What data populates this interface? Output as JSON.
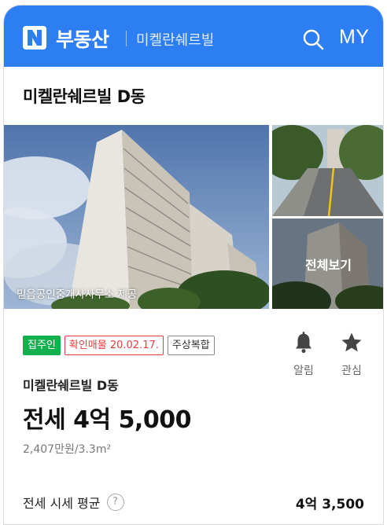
{
  "header": {
    "logo_letter": "N",
    "brand": "부동산",
    "complex": "미켈란쉐르빌",
    "my_label": "MY",
    "color": "#2e7ef3"
  },
  "title": "미켈란쉐르빌 D동",
  "photos": {
    "credit": "믿음공인중개사사무소 제공",
    "view_all": "전체보기"
  },
  "tags": {
    "owner": "집주인",
    "confirm": "확인매물 20.02.17.",
    "type": "주상복합"
  },
  "actions": {
    "alarm_label": "알림",
    "favorite_label": "관심"
  },
  "listing": {
    "name": "미켈란쉐르빌 D동",
    "price": "전세 4억 5,000",
    "unit_price": "2,407만원/3.3m²"
  },
  "average": {
    "label": "전세 시세 평균",
    "help": "?",
    "value": "4억 3,500"
  }
}
